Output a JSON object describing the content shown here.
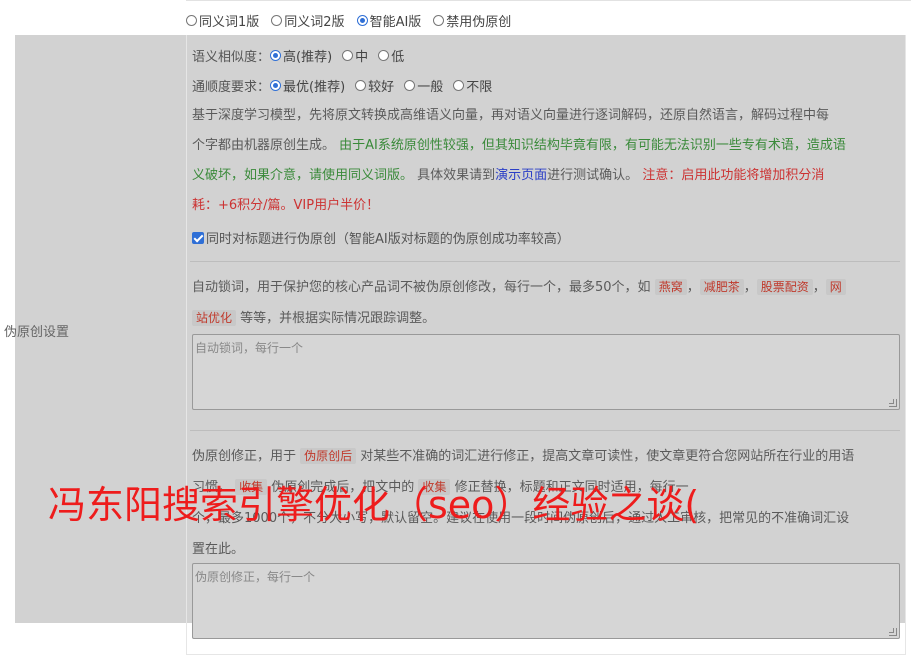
{
  "version_options": [
    {
      "label": "同义词1版",
      "checked": false
    },
    {
      "label": "同义词2版",
      "checked": false
    },
    {
      "label": "智能AI版",
      "checked": true
    },
    {
      "label": "禁用伪原创",
      "checked": false
    }
  ],
  "section_label": "伪原创设置",
  "similarity": {
    "label": "语义相似度：",
    "options": [
      {
        "label": "高(推荐)",
        "checked": true
      },
      {
        "label": "中",
        "checked": false
      },
      {
        "label": "低",
        "checked": false
      }
    ]
  },
  "fluency": {
    "label": "通顺度要求：",
    "options": [
      {
        "label": "最优(推荐)",
        "checked": true
      },
      {
        "label": "较好",
        "checked": false
      },
      {
        "label": "一般",
        "checked": false
      },
      {
        "label": "不限",
        "checked": false
      }
    ]
  },
  "description": {
    "line1": "基于深度学习模型，先将原文转换成高维语义向量，再对语义向量进行逐词解码，还原自然语言，解码过程中每",
    "line2_plain": "个字都由机器原创生成。 ",
    "line2_green": "由于AI系统原创性较强，但其知识结构毕竟有限，有可能无法识别一些专有术语，造成语",
    "line3_green": "义破坏，如果介意，请使用同义词版。",
    "line3_plain": " 具体效果请到",
    "line3_link": "演示页面",
    "line3_plain2": "进行测试确认。 ",
    "line3_red": "注意：启用此功能将增加积分消",
    "line4_red": "耗：+6积分/篇。VIP用户半价！"
  },
  "title_checkbox": {
    "label": "同时对标题进行伪原创（智能AI版对标题的伪原创成功率较高）",
    "checked": true
  },
  "lock_words": {
    "desc_prefix": "自动锁词，用于保护您的核心产品词不被伪原创修改，每行一个，最多50个，如 ",
    "tags": [
      "燕窝",
      "减肥茶",
      "股票配资",
      "网站优化"
    ],
    "sep": "，",
    "tag4_part1": "网",
    "tag4_part2": "站优化",
    "desc_suffix": " 等等，并根据实际情况跟踪调整。",
    "placeholder": "自动锁词，每行一个"
  },
  "correction": {
    "line1_prefix": "伪原创修正，用于 ",
    "line1_tag": "伪原创后",
    "line1_suffix": " 对某些不准确的词汇进行修正，提高文章可读性，使文章更符合您网站所在行业的用语",
    "line2_prefix": "习惯。 ",
    "line2_tag1": "收集",
    "line2_mid": " 伪原创完成后，把文中的 ",
    "line2_tag2": "收集",
    "line2_suffix": " 修正替换，标题和正文同时适用，每行一",
    "line3": "个，最多1000个，不分大小写，默认留空。建议在使用一段时间伪原创后，通过人工审核，把常见的不准确词汇设",
    "line4": "置在此。",
    "placeholder": "伪原创修正，每行一个"
  },
  "watermark": "冯东阳搜索引擎优化（seo）经验之谈("
}
